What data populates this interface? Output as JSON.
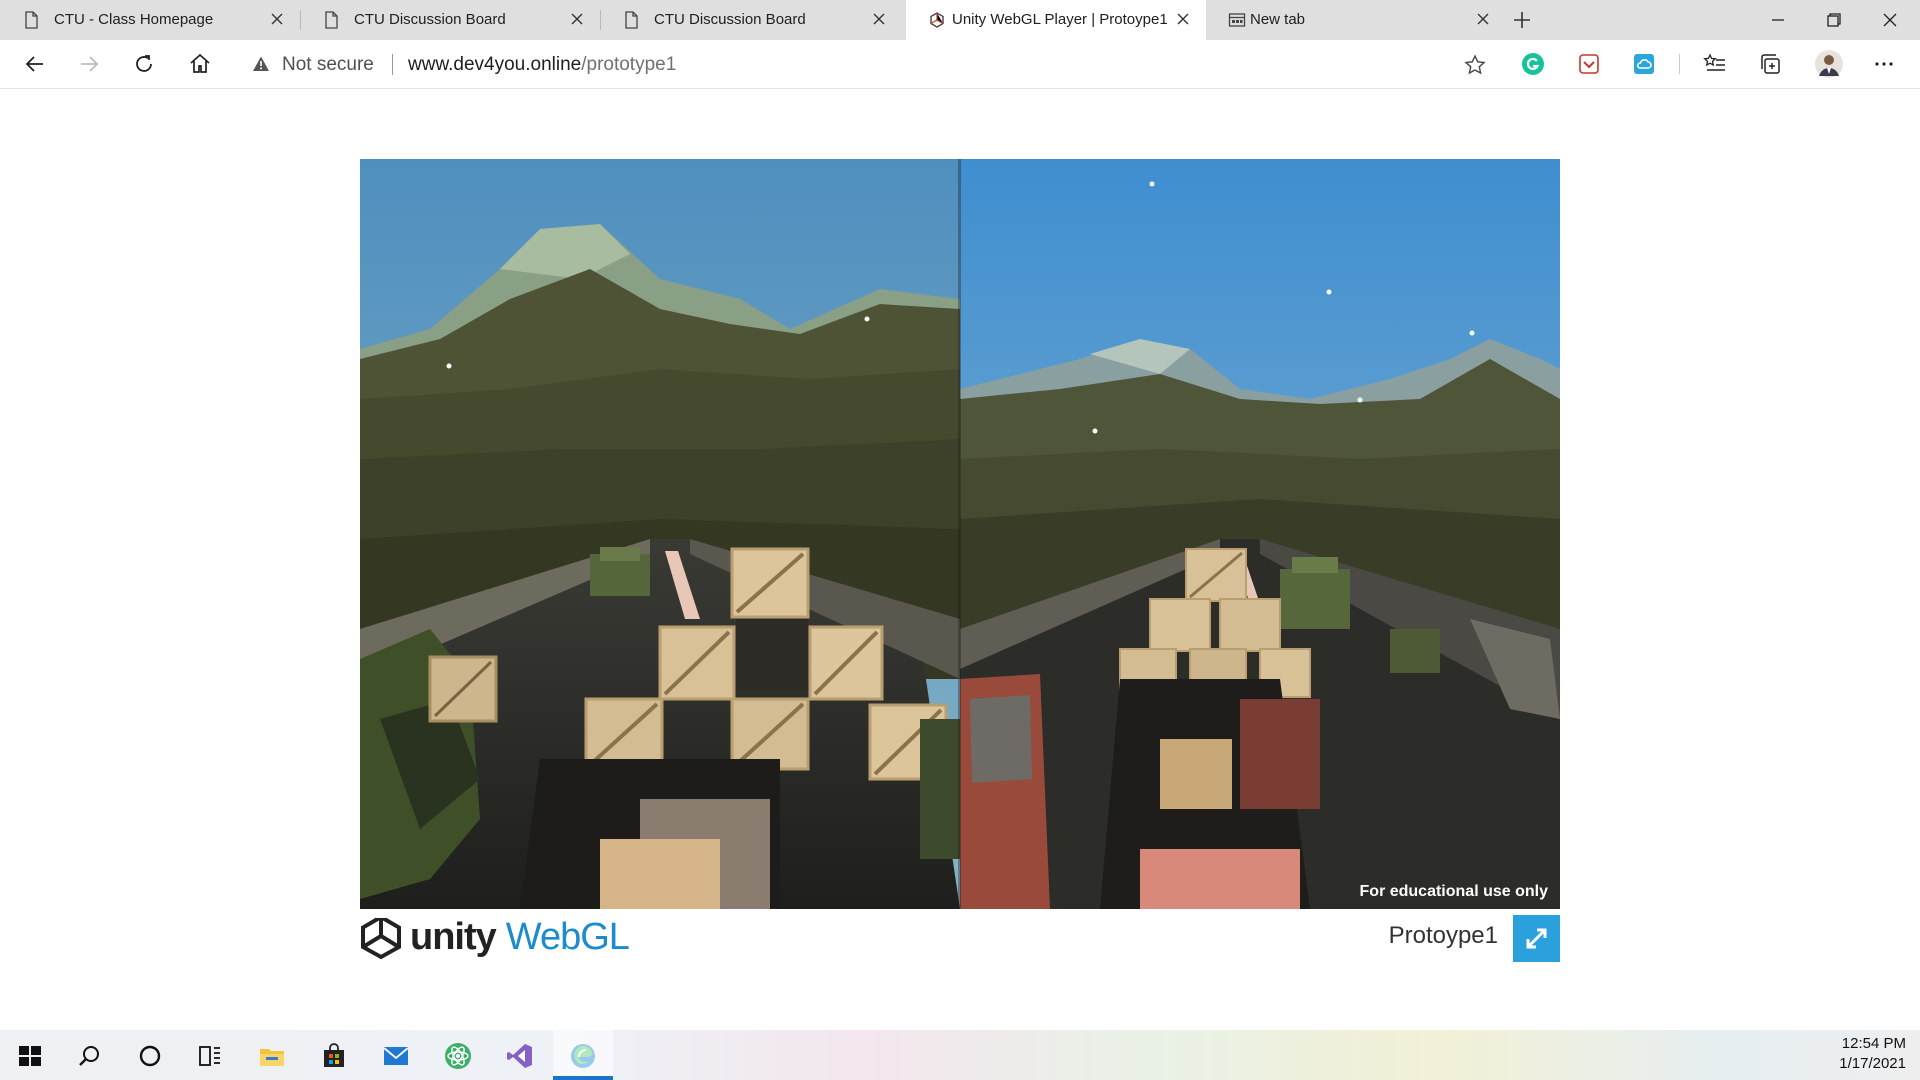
{
  "browser": {
    "tabs": [
      {
        "title": "CTU - Class Homepage",
        "icon": "page-icon",
        "active": false
      },
      {
        "title": "CTU Discussion Board",
        "icon": "page-icon",
        "active": false
      },
      {
        "title": "CTU Discussion Board",
        "icon": "page-icon",
        "active": false
      },
      {
        "title": "Unity WebGL Player | Protoype1",
        "icon": "unity-favicon",
        "active": true
      },
      {
        "title": "New tab",
        "icon": "new-tab-icon",
        "active": false
      }
    ],
    "address": {
      "security_label": "Not secure",
      "url_host": "www.dev4you.online",
      "url_path": "/prototype1"
    },
    "extensions": [
      "grammarly-icon",
      "pocket-icon",
      "cloud-icon"
    ],
    "toolbar_icons": [
      "favorites-icon",
      "collections-icon",
      "profile-avatar",
      "more-icon"
    ]
  },
  "player": {
    "overlay_text": "For educational use only",
    "logo_text": "unity",
    "logo_webgl": "WebGL",
    "project_title": "Protoype1",
    "fullscreen_icon": "fullscreen-icon"
  },
  "taskbar": {
    "icons": [
      "windows-start-icon",
      "search-icon",
      "cortana-icon",
      "task-view-icon",
      "file-explorer-icon",
      "store-icon",
      "mail-icon",
      "atom-icon",
      "visual-studio-icon",
      "edge-icon"
    ],
    "time": "12:54 PM",
    "date": "1/17/2021"
  },
  "colors": {
    "tabstrip": "#dfdfdf",
    "accent": "#2aa0dc",
    "sky_left": "#4f8fbf",
    "sky_right": "#3f8ed0"
  }
}
